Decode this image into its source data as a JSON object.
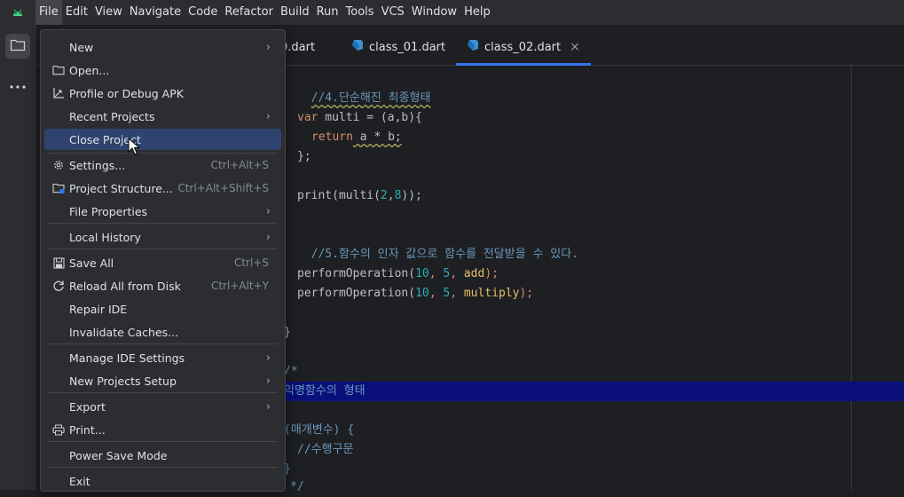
{
  "menubar": {
    "items": [
      "File",
      "Edit",
      "View",
      "Navigate",
      "Code",
      "Refactor",
      "Build",
      "Run",
      "Tools",
      "VCS",
      "Window",
      "Help"
    ]
  },
  "tabs": [
    {
      "label": "0.dart"
    },
    {
      "label": "class_01.dart"
    },
    {
      "label": "class_02.dart",
      "close": "×"
    }
  ],
  "file_menu": {
    "items": [
      {
        "label": "New",
        "submenu": true
      },
      {
        "label": "Open...",
        "icon": "folder-icon"
      },
      {
        "label": "Profile or Debug APK",
        "icon": "profile-apk-icon"
      },
      {
        "label": "Recent Projects",
        "submenu": true
      },
      {
        "label": "Close Project",
        "selected": true
      },
      {
        "label": "Settings...",
        "shortcut": "Ctrl+Alt+S",
        "icon": "gear-icon"
      },
      {
        "label": "Project Structure...",
        "shortcut": "Ctrl+Alt+Shift+S",
        "icon": "project-structure-icon"
      },
      {
        "label": "File Properties",
        "submenu": true
      },
      {
        "label": "Local History",
        "submenu": true
      },
      {
        "label": "Save All",
        "shortcut": "Ctrl+S",
        "icon": "save-icon"
      },
      {
        "label": "Reload All from Disk",
        "shortcut": "Ctrl+Alt+Y",
        "icon": "reload-icon"
      },
      {
        "label": "Repair IDE"
      },
      {
        "label": "Invalidate Caches..."
      },
      {
        "label": "Manage IDE Settings",
        "submenu": true
      },
      {
        "label": "New Projects Setup",
        "submenu": true
      },
      {
        "label": "Export",
        "submenu": true
      },
      {
        "label": "Print...",
        "icon": "print-icon"
      },
      {
        "label": "Power Save Mode"
      },
      {
        "label": "Exit"
      }
    ],
    "submenu_arrow": "›"
  },
  "code": {
    "comment4": "//4.단순해진 최종형태",
    "var_kw": "var",
    "multi_decl": " multi = (a,b){",
    "return_kw": "return",
    "return_expr": " a * b;",
    "close_brace_semicolon": "};",
    "print_start": "print(multi(",
    "print_n1": "2",
    "print_comma": ",",
    "print_n2": "8",
    "print_end": "));",
    "comment5": "//5.함수의 인자 값으로 함수를 전달받을 수 있다.",
    "perf_fn": "performOperation(",
    "perf_a": "10",
    "perf_sep": ", ",
    "perf_b": "5",
    "perf_add": "add",
    "perf_multiply": "multiply",
    "perf_end": ");",
    "closing_brace": "}",
    "block_comment_open": "/*",
    "anon_fn_form": "익명함수의 형태",
    "params_line": "(매개변수) {",
    "body_comment": "//수행구문",
    "brace_close": "}",
    "block_comment_close": "*/"
  },
  "colors": {
    "accent": "#3574f0",
    "selection": "#2e436e",
    "highlight": "#0a0f7a"
  }
}
